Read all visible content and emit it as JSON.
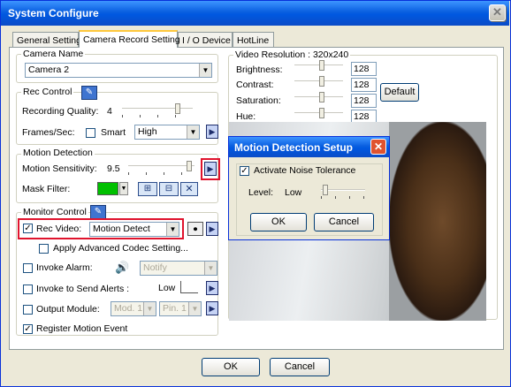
{
  "window": {
    "title": "System Configure",
    "close_glyph": "✕"
  },
  "tabs": [
    {
      "label": "General Setting"
    },
    {
      "label": "Camera Record Setting"
    },
    {
      "label": "I / O Device"
    },
    {
      "label": "HotLine"
    }
  ],
  "camera_name": {
    "legend": "Camera Name",
    "value": "Camera 2"
  },
  "rec_control": {
    "legend": "Rec Control",
    "quality_label": "Recording Quality:",
    "quality_value": "4",
    "frames_label": "Frames/Sec:",
    "smart_label": "Smart",
    "frames_value": "High"
  },
  "motion_detection": {
    "legend": "Motion Detection",
    "sensitivity_label": "Motion Sensitivity:",
    "sensitivity_value": "9.5",
    "mask_label": "Mask Filter:",
    "mask_color": "#00c000"
  },
  "monitor_control": {
    "legend": "Monitor Control",
    "rec_video_label": "Rec Video:",
    "rec_video_value": "Motion Detect",
    "advanced_codec_label": "Apply Advanced Codec Setting...",
    "invoke_alarm_label": "Invoke Alarm:",
    "alarm_value": "Notify",
    "send_alerts_label": "Invoke to Send Alerts :",
    "send_alerts_level": "Low",
    "output_module_label": "Output Module:",
    "mod_value": "Mod. 1",
    "pin_value": "Pin. 1",
    "register_label": "Register Motion Event"
  },
  "video": {
    "resolution_label": "Video Resolution : 320x240",
    "brightness_label": "Brightness:",
    "brightness_value": "128",
    "contrast_label": "Contrast:",
    "contrast_value": "128",
    "saturation_label": "Saturation:",
    "saturation_value": "128",
    "hue_label": "Hue:",
    "hue_value": "128",
    "default_label": "Default"
  },
  "dialog": {
    "title": "Motion Detection Setup",
    "close_glyph": "✕",
    "noise_label": "Activate Noise Tolerance",
    "level_label": "Level:",
    "level_value": "Low",
    "ok_label": "OK",
    "cancel_label": "Cancel"
  },
  "footer": {
    "ok_label": "OK",
    "cancel_label": "Cancel"
  },
  "accent": {
    "red_highlight": "#e0132d",
    "xp_blue": "#0a5fe0"
  }
}
